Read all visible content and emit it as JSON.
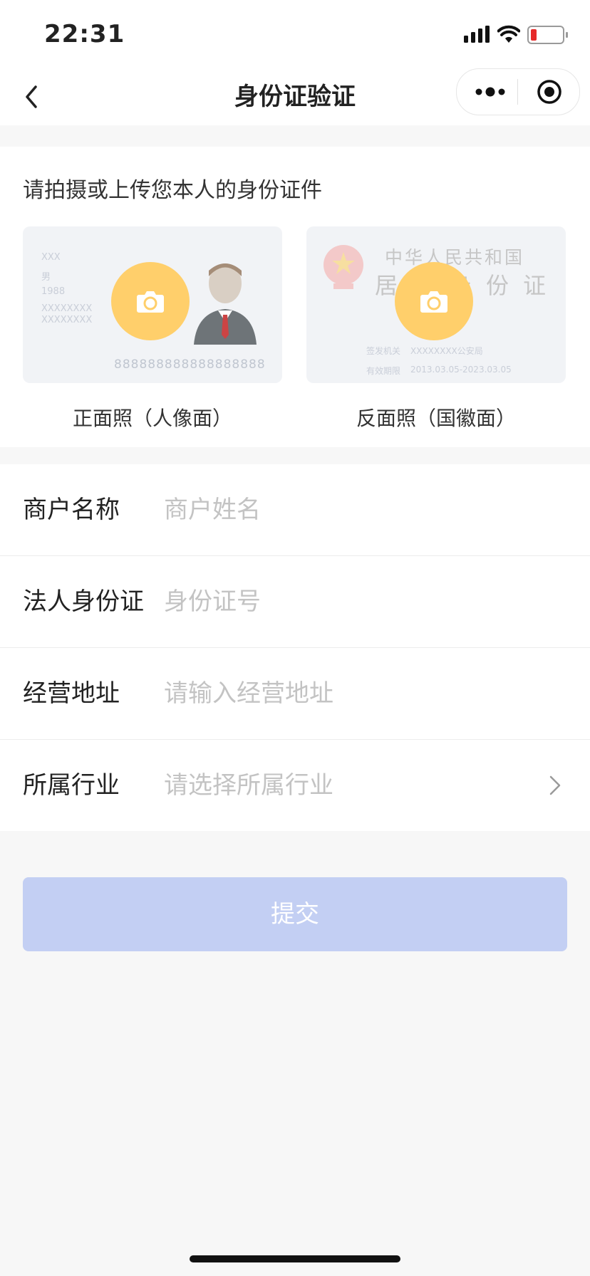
{
  "status_bar": {
    "time": "22:31",
    "signal_icon": "cellular-signal-icon",
    "wifi_icon": "wifi-icon",
    "battery_icon": "battery-low-icon",
    "battery_level": 0.12
  },
  "nav": {
    "title": "身份证验证",
    "back_icon": "chevron-left-icon",
    "more_icon": "more-dots-icon",
    "close_icon": "target-circle-icon"
  },
  "upload": {
    "prompt": "请拍摄或上传您本人的身份证件",
    "front_caption": "正面照（人像面）",
    "back_caption": "反面照（国徽面）",
    "front_sample": {
      "name": "XXX",
      "gender": "男",
      "year": "1988",
      "address": "XXXXXXXX",
      "address2": "XXXXXXXX",
      "id_number": "888888888888888888"
    },
    "back_sample": {
      "title_line1": "中华人民共和国",
      "title_line2": "居民身份证",
      "authority_label": "签发机关",
      "authority": "XXXXXXXX公安局",
      "validity_label": "有效期限",
      "validity": "2013.03.05-2023.03.05"
    },
    "camera_icon": "camera-icon",
    "accent_color": "#ffcf6b"
  },
  "form": {
    "merchant_label": "商户名称",
    "merchant_placeholder": "商户姓名",
    "id_label": "法人身份证",
    "id_placeholder": "身份证号",
    "address_label": "经营地址",
    "address_placeholder": "请输入经营地址",
    "industry_label": "所属行业",
    "industry_placeholder": "请选择所属行业"
  },
  "submit_label": "提交",
  "submit_color": "#c3cff3"
}
